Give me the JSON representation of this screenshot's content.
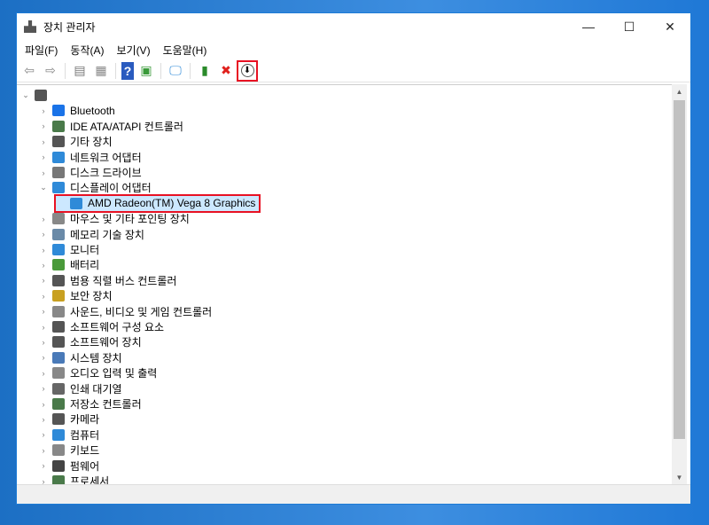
{
  "window": {
    "title": "장치 관리자",
    "minimize": "—",
    "maximize": "☐",
    "close": "✕"
  },
  "menu": [
    "파일(F)",
    "동작(A)",
    "보기(V)",
    "도움말(H)"
  ],
  "toolbar": [
    {
      "name": "back-icon",
      "glyph": "⇦",
      "color": "#888"
    },
    {
      "name": "forward-icon",
      "glyph": "⇨",
      "color": "#888"
    },
    {
      "name": "sep"
    },
    {
      "name": "show-hide-console-tree-icon",
      "glyph": "▤",
      "color": "#777"
    },
    {
      "name": "properties-icon",
      "glyph": "▦",
      "color": "#888"
    },
    {
      "name": "sep"
    },
    {
      "name": "help-icon",
      "glyph": "?",
      "color": "#fff",
      "bg": "#2a5bbf"
    },
    {
      "name": "action-pane-icon",
      "glyph": "▣",
      "color": "#3a9a3a"
    },
    {
      "name": "sep"
    },
    {
      "name": "scan-hardware-icon",
      "glyph": "🖵",
      "color": "#2f8ad8"
    },
    {
      "name": "sep"
    },
    {
      "name": "update-driver-icon",
      "glyph": "▮",
      "color": "#2a8a2a"
    },
    {
      "name": "uninstall-device-icon",
      "glyph": "✖",
      "color": "#e0201c"
    },
    {
      "name": "rollback-driver-icon",
      "glyph": "⬇",
      "color": "#111",
      "highlight": true
    }
  ],
  "tree": {
    "root": "",
    "categories": [
      {
        "label": "Bluetooth",
        "color": "#1a73e8"
      },
      {
        "label": "IDE ATA/ATAPI 컨트롤러",
        "color": "#4a7a4a"
      },
      {
        "label": "기타 장치",
        "color": "#555"
      },
      {
        "label": "네트워크 어댑터",
        "color": "#2f8ad8"
      },
      {
        "label": "디스크 드라이브",
        "color": "#777"
      },
      {
        "label": "디스플레이 어댑터",
        "color": "#2f8ad8",
        "expanded": true,
        "children": [
          {
            "label": "AMD Radeon(TM) Vega 8 Graphics",
            "selected": true
          }
        ]
      },
      {
        "label": "마우스 및 기타 포인팅 장치",
        "color": "#888"
      },
      {
        "label": "메모리 기술 장치",
        "color": "#6a8aa8"
      },
      {
        "label": "모니터",
        "color": "#2f8ad8"
      },
      {
        "label": "배터리",
        "color": "#4a9a3a"
      },
      {
        "label": "범용 직렬 버스 컨트롤러",
        "color": "#555"
      },
      {
        "label": "보안 장치",
        "color": "#c8a020"
      },
      {
        "label": "사운드, 비디오 및 게임 컨트롤러",
        "color": "#888"
      },
      {
        "label": "소프트웨어 구성 요소",
        "color": "#555"
      },
      {
        "label": "소프트웨어 장치",
        "color": "#555"
      },
      {
        "label": "시스템 장치",
        "color": "#4a7ab8"
      },
      {
        "label": "오디오 입력 및 출력",
        "color": "#888"
      },
      {
        "label": "인쇄 대기열",
        "color": "#666"
      },
      {
        "label": "저장소 컨트롤러",
        "color": "#4a7a4a"
      },
      {
        "label": "카메라",
        "color": "#555"
      },
      {
        "label": "컴퓨터",
        "color": "#2f8ad8"
      },
      {
        "label": "키보드",
        "color": "#888"
      },
      {
        "label": "펌웨어",
        "color": "#444"
      },
      {
        "label": "프로세서",
        "color": "#4a7a4a"
      }
    ]
  }
}
